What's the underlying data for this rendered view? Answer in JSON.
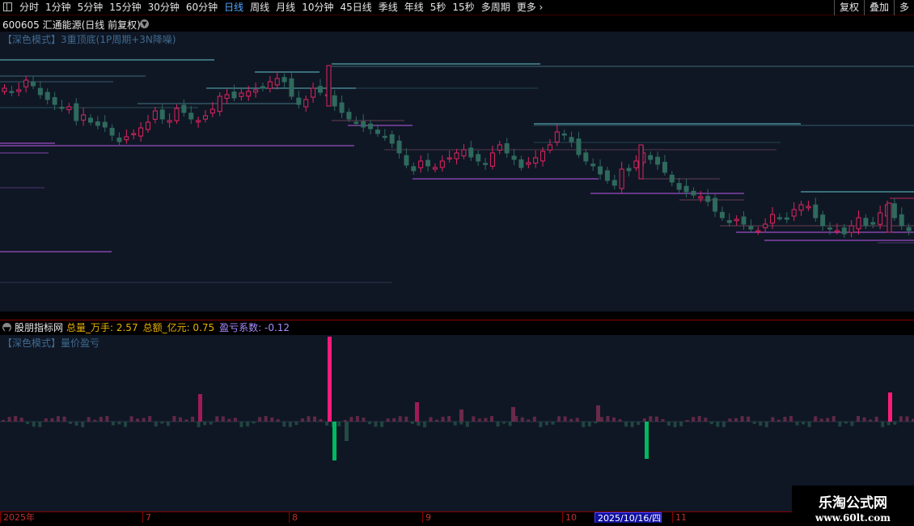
{
  "toolbar": {
    "periods": [
      "分时",
      "1分钟",
      "5分钟",
      "15分钟",
      "30分钟",
      "60分钟",
      "日线",
      "周线",
      "月线",
      "10分钟",
      "45日线",
      "季线",
      "年线",
      "5秒",
      "15秒",
      "多周期",
      "更多 ›"
    ],
    "active_period": "日线",
    "right_buttons": [
      "复权",
      "叠加",
      "多"
    ]
  },
  "stock": {
    "title": "600605 汇通能源(日线 前复权)"
  },
  "main_panel": {
    "label": "【深色模式】3重顶底(1P周期+3N降噪)"
  },
  "indicator": {
    "name": "股朋指标网",
    "items": [
      {
        "label": "总量_万手: 2.57",
        "color": "#e8b000"
      },
      {
        "label": "总额_亿元: 0.75",
        "color": "#e8b000"
      },
      {
        "label": "盈亏系数: -0.12",
        "color": "#a98cff"
      }
    ],
    "panel_label": "【深色模式】量价盈亏"
  },
  "date_axis": {
    "ticks": [
      "2025年",
      "7",
      "8",
      "9",
      "10",
      "2025/10/16/四",
      "11"
    ],
    "selected": "2025/10/16/四"
  },
  "watermark": {
    "title": "乐淘公式网",
    "url": "www.60lt.com"
  },
  "colors": {
    "up": "#e0245e",
    "down": "#2f6a5d",
    "support": "#d060ff",
    "resistance": "#6fd8df",
    "bar_up": "#ff1a7a",
    "bar_down": "#00b860"
  }
}
